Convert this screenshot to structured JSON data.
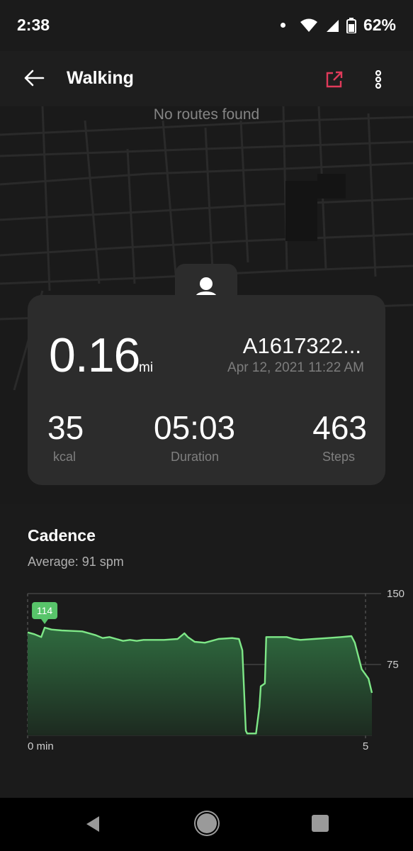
{
  "status_bar": {
    "time": "2:38",
    "battery": "62%"
  },
  "app_bar": {
    "title": "Walking",
    "back_icon": "arrow-left-icon",
    "share_icon": "share-external-icon",
    "more_icon": "more-vertical-icon",
    "share_color": "#e03a5a"
  },
  "map": {
    "empty_text": "No routes found"
  },
  "summary": {
    "distance": "0.16",
    "distance_unit": "mi",
    "device_name": "A1617322...",
    "date": "Apr 12, 2021 11:22 AM",
    "avatar_icon": "user-icon",
    "stats": [
      {
        "value": "35",
        "label": "kcal"
      },
      {
        "value": "05:03",
        "label": "Duration"
      },
      {
        "value": "463",
        "label": "Steps"
      }
    ]
  },
  "cadence": {
    "title": "Cadence",
    "average": "Average: 91 spm"
  },
  "chart_data": {
    "type": "area",
    "title": "Cadence",
    "xlabel": "",
    "ylabel": "",
    "x_ticks": [
      "0 min",
      "5"
    ],
    "y_ticks": [
      150,
      75
    ],
    "ylim": [
      0,
      150
    ],
    "xlim": [
      0,
      5.05
    ],
    "grid": true,
    "peak_label": "114",
    "line_color": "#7ee787",
    "fill_color": "#2f6b3f",
    "series": [
      {
        "x": [
          0,
          0.1,
          0.2,
          0.25,
          0.35,
          0.5,
          0.8,
          1.0,
          1.1,
          1.2,
          1.3,
          1.4,
          1.5,
          1.6,
          1.7,
          1.8,
          2.0,
          2.2,
          2.3,
          2.35,
          2.45,
          2.6,
          2.8,
          3.0,
          3.1,
          3.15,
          3.2,
          3.22,
          3.3,
          3.35,
          3.4,
          3.42,
          3.48,
          3.5,
          3.6,
          3.8,
          3.9,
          4.0,
          4.2,
          4.4,
          4.6,
          4.75,
          4.8,
          4.9,
          5.0,
          5.05
        ],
        "y": [
          109,
          107,
          104,
          114,
          112,
          111,
          110,
          106,
          103,
          104,
          102,
          100,
          101,
          100,
          101,
          101,
          101,
          102,
          108,
          104,
          99,
          98,
          102,
          103,
          102,
          90,
          5,
          2,
          2,
          2,
          30,
          52,
          55,
          104,
          104,
          104,
          102,
          101,
          102,
          103,
          104,
          105,
          98,
          70,
          60,
          45
        ]
      }
    ]
  }
}
